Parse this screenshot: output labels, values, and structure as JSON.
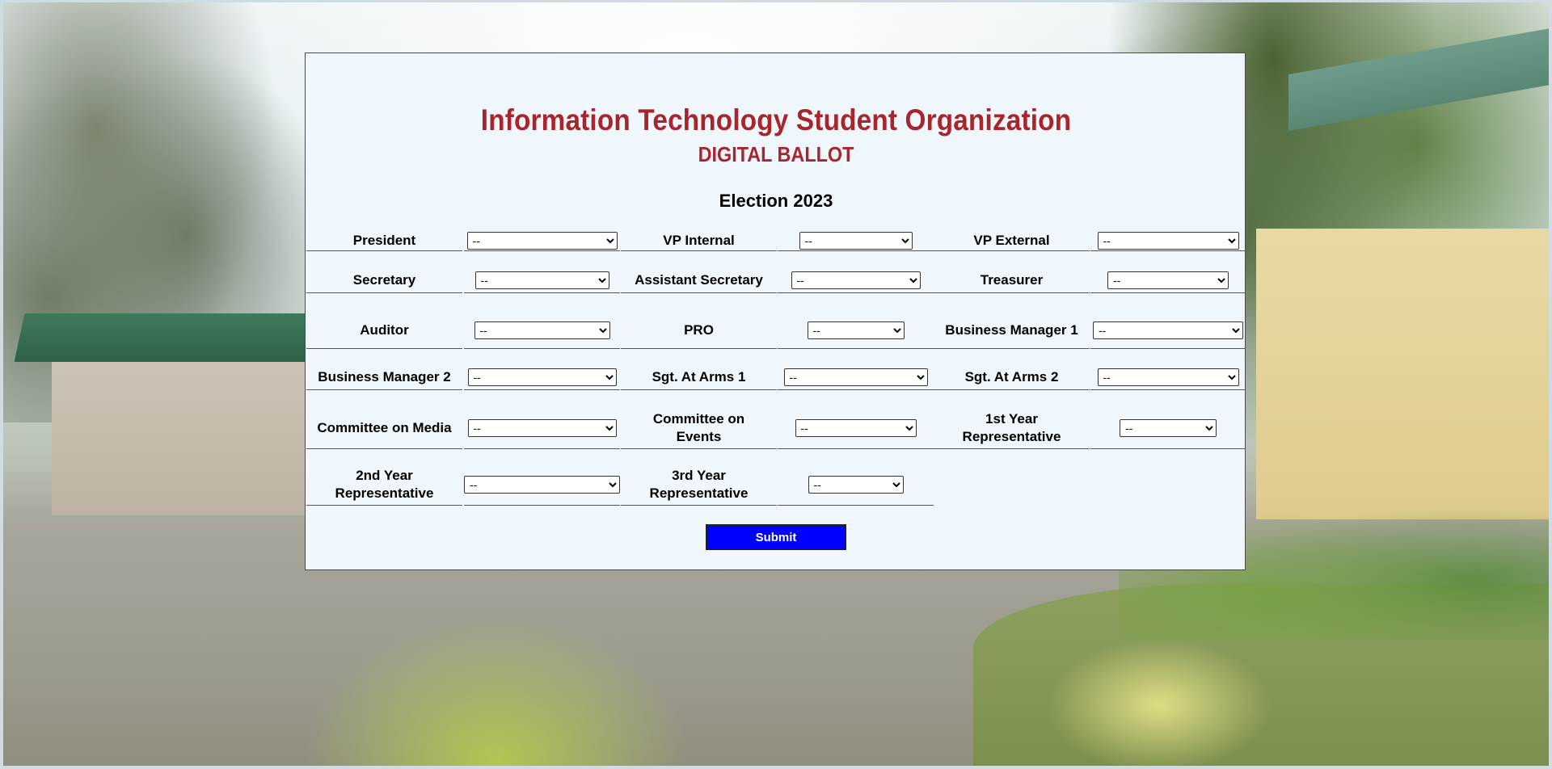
{
  "header": {
    "title": "Information Technology Student Organization",
    "subtitle": "DIGITAL BALLOT",
    "election": "Election 2023"
  },
  "positions": [
    {
      "label": "President",
      "selected": "--"
    },
    {
      "label": "VP Internal",
      "selected": "--"
    },
    {
      "label": "VP External",
      "selected": "--"
    },
    {
      "label": "Secretary",
      "selected": "--"
    },
    {
      "label": "Assistant Secretary",
      "selected": "--"
    },
    {
      "label": "Treasurer",
      "selected": "--"
    },
    {
      "label": "Auditor",
      "selected": "--"
    },
    {
      "label": "PRO",
      "selected": "--"
    },
    {
      "label": "Business Manager 1",
      "selected": "--"
    },
    {
      "label": "Business Manager 2",
      "selected": "--"
    },
    {
      "label": "Sgt. At Arms 1",
      "selected": "--"
    },
    {
      "label": "Sgt. At Arms 2",
      "selected": "--"
    },
    {
      "label": "Committee on Media",
      "selected": "--"
    },
    {
      "label": "Committee on Events",
      "selected": "--"
    },
    {
      "label": "1st Year Representative",
      "selected": "--"
    },
    {
      "label": "2nd Year Representative",
      "selected": "--"
    },
    {
      "label": "3rd Year Representative",
      "selected": "--"
    }
  ],
  "submit_label": "Submit"
}
